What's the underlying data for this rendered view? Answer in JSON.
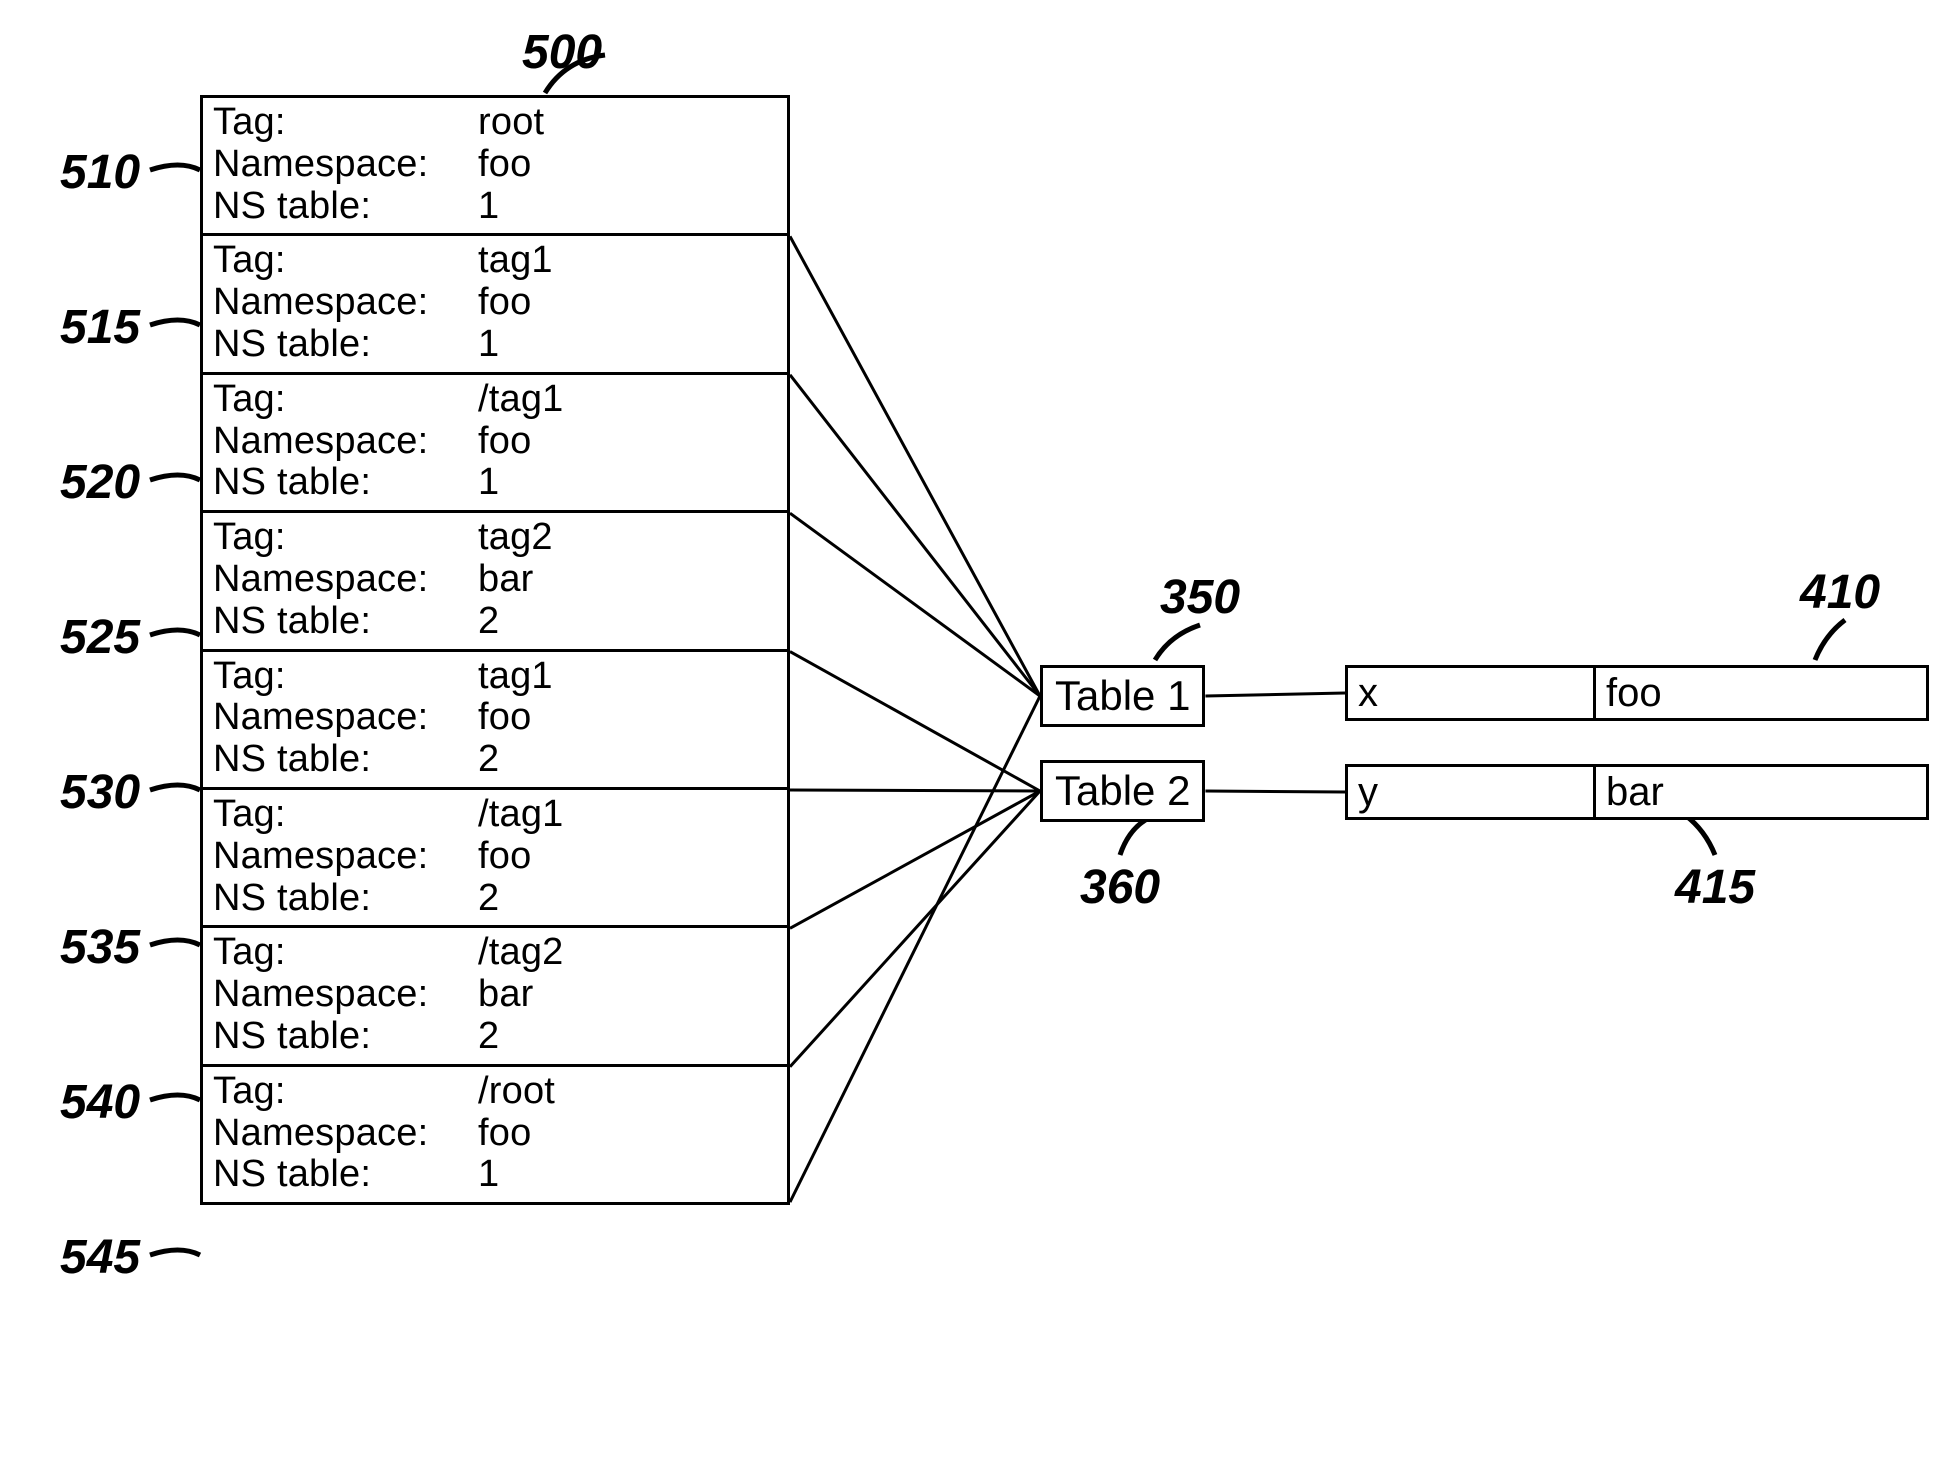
{
  "refs": {
    "r500": "500",
    "r510": "510",
    "r515": "515",
    "r520": "520",
    "r525": "525",
    "r530": "530",
    "r535": "535",
    "r540": "540",
    "r545": "545",
    "r350": "350",
    "r360": "360",
    "r410": "410",
    "r415": "415"
  },
  "field_labels": {
    "tag": "Tag:",
    "ns": "Namespace:",
    "nst": "NS table:"
  },
  "events": [
    {
      "tag": "root",
      "ns": "foo",
      "nst": "1"
    },
    {
      "tag": "tag1",
      "ns": "foo",
      "nst": "1"
    },
    {
      "tag": "/tag1",
      "ns": "foo",
      "nst": "1"
    },
    {
      "tag": "tag2",
      "ns": "bar",
      "nst": "2"
    },
    {
      "tag": "tag1",
      "ns": "foo",
      "nst": "2"
    },
    {
      "tag": "/tag1",
      "ns": "foo",
      "nst": "2"
    },
    {
      "tag": "/tag2",
      "ns": "bar",
      "nst": "2"
    },
    {
      "tag": "/root",
      "ns": "foo",
      "nst": "1"
    }
  ],
  "tables": {
    "t1": "Table 1",
    "t2": "Table 2"
  },
  "nsmaps": {
    "m1": {
      "prefix": "x",
      "uri": "foo"
    },
    "m2": {
      "prefix": "y",
      "uri": "bar"
    }
  },
  "connectors_events": [
    {
      "from_event": 0,
      "to": "t1"
    },
    {
      "from_event": 1,
      "to": "t1"
    },
    {
      "from_event": 2,
      "to": "t1"
    },
    {
      "from_event": 3,
      "to": "t2"
    },
    {
      "from_event": 4,
      "to": "t2"
    },
    {
      "from_event": 5,
      "to": "t2"
    },
    {
      "from_event": 6,
      "to": "t2"
    },
    {
      "from_event": 7,
      "to": "t1"
    }
  ],
  "connectors_tables": [
    {
      "from": "t1",
      "to": "m1"
    },
    {
      "from": "t2",
      "to": "m2"
    }
  ]
}
